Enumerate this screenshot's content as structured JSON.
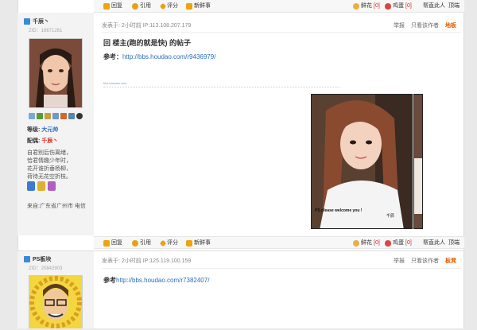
{
  "toolbar": {
    "reply": "回复",
    "quote": "引用",
    "rate": "评分",
    "new_post": "新鲜事",
    "flower_label": "鲜花",
    "flower_count": "[0]",
    "egg_label": "鸡蛋",
    "egg_count": "[0]",
    "help_him": "帮直此人",
    "tip": "顶端"
  },
  "post1": {
    "time_ip": "发表于: 2小时前    IP:113.108.207.179",
    "report": "举报",
    "only_author": "只看该作者",
    "floor": "地板",
    "username": "千辰丶",
    "zid": "ZID：18671261",
    "level_label": "等级:",
    "level_value": "大元帅",
    "partner_label": "配偶:",
    "partner_value": "千辰丶",
    "signature": [
      "自君别后伤离绪，",
      "恰君情趣少年时，",
      "花开谁折垂杨柳，",
      "荷待无花空折枝。"
    ],
    "from": "来自:广东省广州市 电信",
    "title": "回 楼主(跑的就是快) 的帖子",
    "ref_label": "参考：",
    "ref_url": "http://bbs.houdao.com/r9436979/",
    "watermark": "bbs.houdao.com",
    "photo_caption": "PS please welcome you !",
    "photo_sign": "千辰"
  },
  "post2": {
    "username": "PS板块",
    "zid": "ZID：20842903",
    "time_ip": "发表于: 2小时前    IP:125.119.100.159",
    "report": "举报",
    "only_author": "只看该作者",
    "floor": "板凳",
    "ref_label": "参考",
    "ref_url": "http://bbs.houdao.com/r7382407/"
  }
}
